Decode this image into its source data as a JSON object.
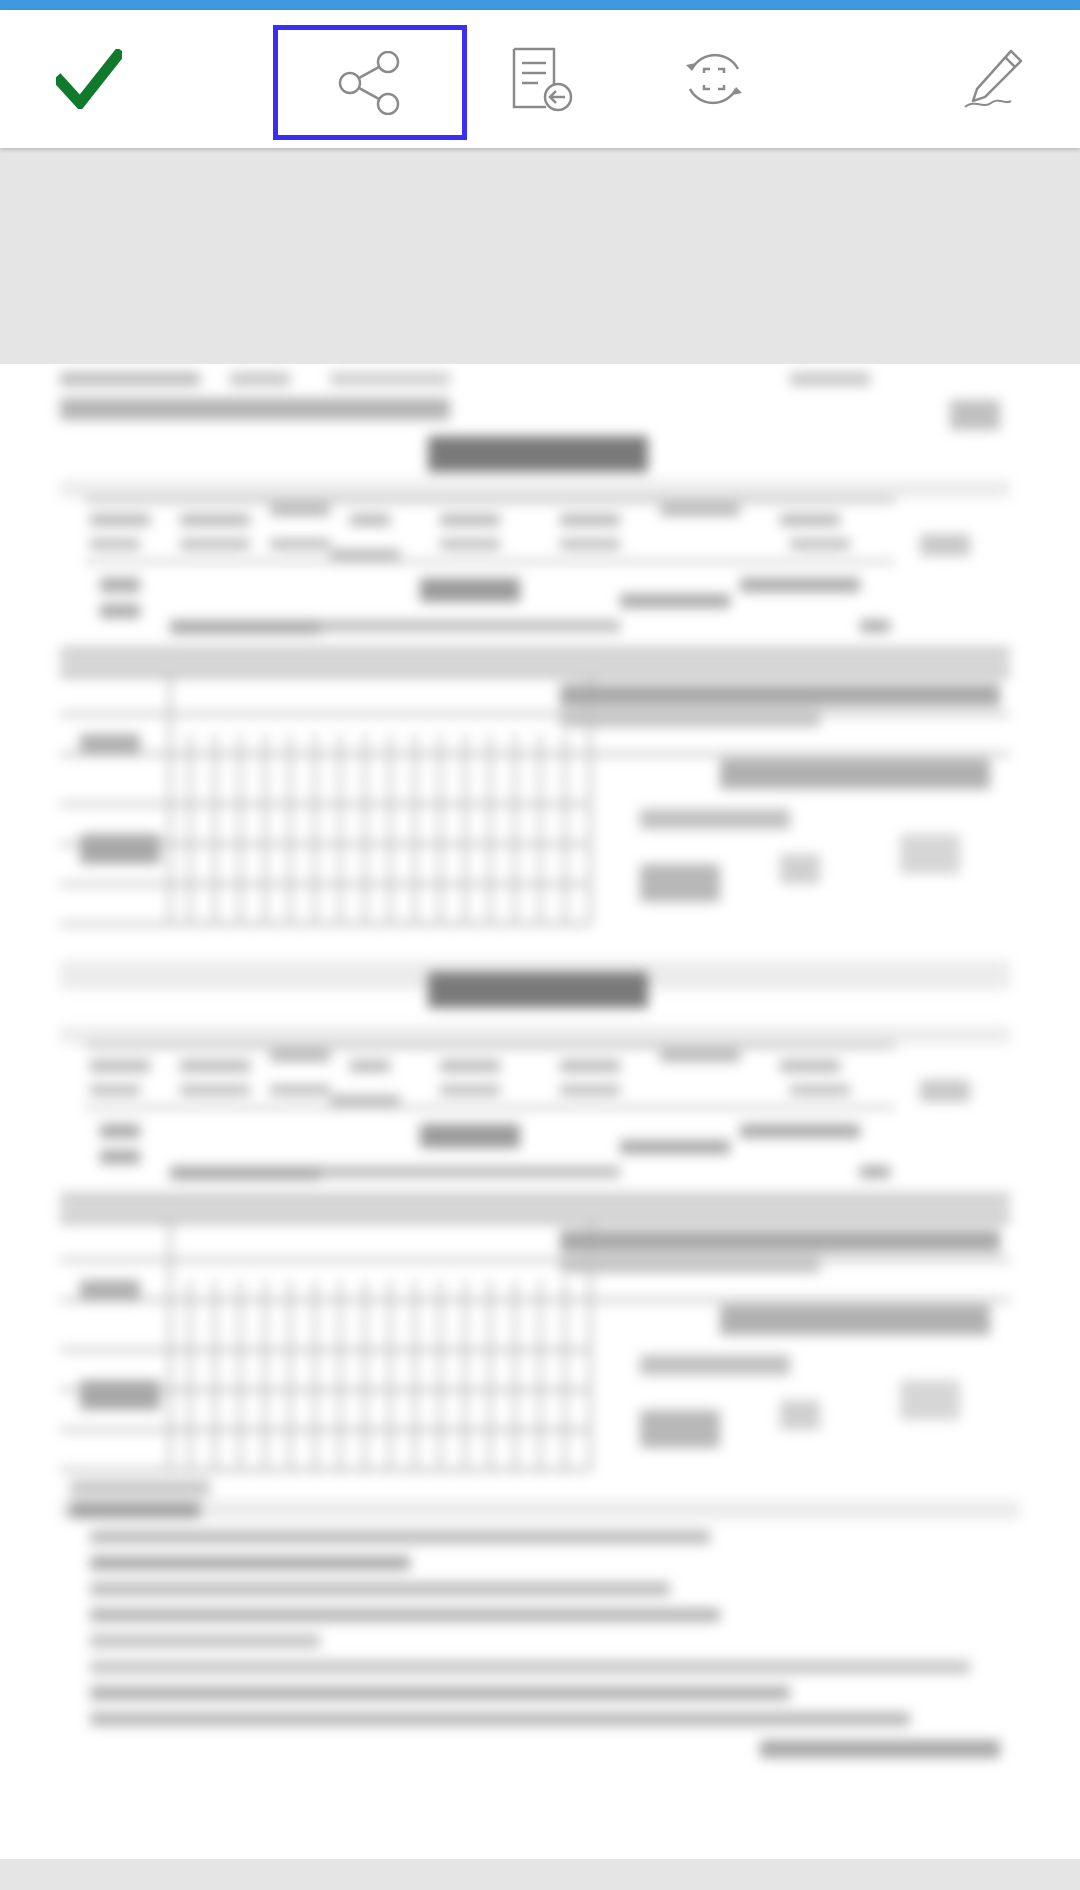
{
  "toolbar": {
    "accent_color": "#3f98e0",
    "items": [
      {
        "name": "done",
        "icon": "checkmark-icon",
        "color": "#0f7a2b"
      },
      {
        "name": "share",
        "icon": "share-icon",
        "selected": true,
        "highlight_color": "#3a2ff0"
      },
      {
        "name": "document",
        "icon": "document-import-icon"
      },
      {
        "name": "rotate",
        "icon": "rotate-crop-icon"
      },
      {
        "name": "sign",
        "icon": "pen-sign-icon"
      }
    ]
  },
  "document": {
    "state": "blurred-scanned-form-preview",
    "sections": 2
  }
}
